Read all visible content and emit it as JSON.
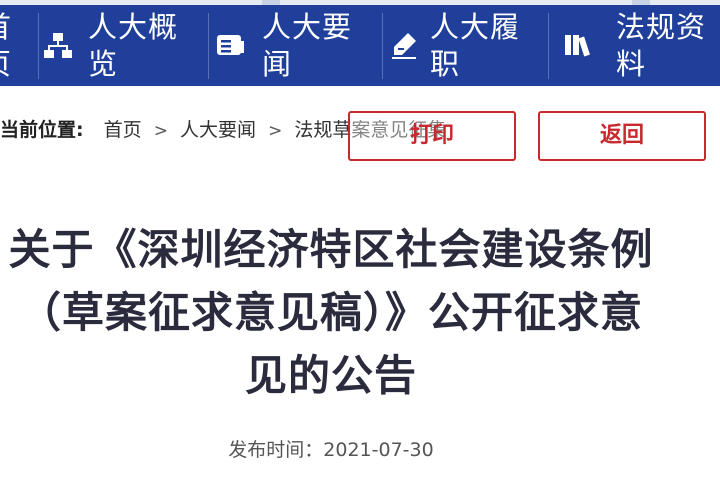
{
  "nav": {
    "items": [
      {
        "label": "首\n页",
        "icon": "home-icon"
      },
      {
        "label": "人大概\n览",
        "icon": "org-chart-icon"
      },
      {
        "label": "人大要\n闻",
        "icon": "news-card-icon"
      },
      {
        "label": "人大履\n职",
        "icon": "pen-signature-icon"
      },
      {
        "label": "法规资\n料",
        "icon": "books-icon"
      }
    ]
  },
  "breadcrumb": {
    "label": "当前位置:",
    "items": [
      "首页",
      "人大要闻",
      "法规草案意见征集"
    ],
    "separator": ">"
  },
  "actions": {
    "print_label": "打印",
    "back_label": "返回"
  },
  "article": {
    "title": "关于《深圳经济特区社会建设条例（草案征求意见稿）》公开征求意见的公告",
    "publish_date": "发布时间：2021-07-30"
  },
  "colors": {
    "nav_bg": "#1f3f9b",
    "accent_red": "#c62a2f",
    "title_text": "#2a2b3d"
  }
}
